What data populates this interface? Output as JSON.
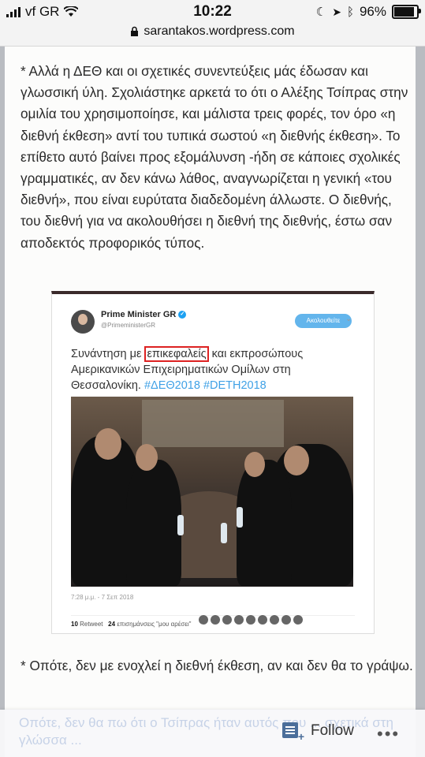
{
  "status_bar": {
    "carrier": "vf GR",
    "time": "10:22",
    "battery": "96%",
    "battery_level": 0.96,
    "icons": [
      "signal-icon",
      "wifi-icon",
      "moon-icon",
      "location-icon",
      "bluetooth-icon",
      "battery-icon"
    ]
  },
  "browser": {
    "url": "sarantakos.wordpress.com",
    "lock_icon": "lock-icon"
  },
  "article": {
    "paragraph1": "* Αλλά η ΔΕΘ και οι σχετικές συνεντεύξεις μάς έδωσαν και γλωσσική ύλη. Σχολιάστηκε αρκετά το ότι ο Αλέξης Τσίπρας στην ομιλία του χρησιμοποίησε, και μάλιστα τρεις φορές, τον όρο «η διεθνή έκθεση» αντί του τυπικά σωστού «η διεθνής έκθεση». Το επίθετο αυτό βαίνει προς εξομάλυνση -ήδη σε κάποιες σχολικές γραμματικές, αν δεν κάνω λάθος, αναγνωρίζεται η γενική «του διεθνή», που είναι ευρύτατα διαδεδομένη άλλωστε. Ο διεθνής, του διεθνή για να ακολουθήσει η διεθνή της διεθνής, έστω σαν αποδεκτός προφορικός τύπος.",
    "paragraph2": "* Οπότε, δεν με ενοχλεί η διεθνή έκθεση, αν και δεν θα το γράψω."
  },
  "tweet": {
    "account_name": "Prime Minister GR",
    "handle": "@PrimeministerGR",
    "follow_label": "Ακολουθείτε",
    "text_before": "Συνάντηση με ",
    "highlighted_word": "επικεφαλείς",
    "text_after": " και εκπροσώπους Αμερικανικών Επιχειρηματικών Ομίλων στη Θεσσαλονίκη. ",
    "hashtags": "#ΔΕΘ2018 #DETH2018",
    "timestamp": "7:28 μ.μ. - 7 Σεπ 2018",
    "retweets_count": "10",
    "retweets_label": "Retweet",
    "likes_count": "24",
    "likes_label": "επισημάνσεις \"μου αρέσει\""
  },
  "follow_bar": {
    "label": "Follow",
    "faded_text": "Οπότε, δεν θα πω ότι ο Τσίπρας ήταν αυτός που ... σχετικά στη γλώσσα ... ",
    "more_label": "•••"
  }
}
